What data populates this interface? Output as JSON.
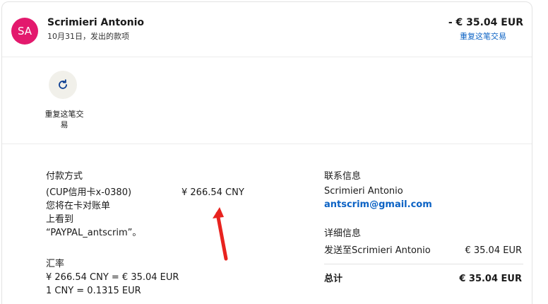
{
  "header": {
    "avatar_initials": "SA",
    "merchant": "Scrimieri Antonio",
    "subtitle": "10月31日，发出的款项",
    "amount": "- € 35.04 EUR",
    "repeat_link": "重复这笔交易"
  },
  "actions": {
    "repeat_label_line1": "重复这笔交",
    "repeat_label_line2": "易"
  },
  "payment": {
    "title": "付款方式",
    "method": "(CUP信用卡x-0380)",
    "amount": "¥ 266.54 CNY",
    "note_line1": "您将在卡对账单",
    "note_line2": "上看到",
    "note_line3": "“PAYPAL_antscrim”。"
  },
  "exchange": {
    "title": "汇率",
    "line1": "¥ 266.54 CNY = € 35.04 EUR",
    "line2": "1 CNY = 0.1315 EUR"
  },
  "contact": {
    "title": "联系信息",
    "name": "Scrimieri Antonio",
    "email": "antscrim@gmail.com"
  },
  "details": {
    "title": "详细信息",
    "sent_to_label": "发送至Scrimieri Antonio",
    "sent_to_amount": "€ 35.04 EUR",
    "total_label": "总计",
    "total_amount": "€ 35.04 EUR"
  },
  "colors": {
    "avatar_bg": "#e3196d",
    "link": "#0b62c4",
    "annotation_arrow": "#e8231f"
  },
  "icons": {
    "repeat": "refresh-icon",
    "annotation": "red-arrow-annotation"
  }
}
